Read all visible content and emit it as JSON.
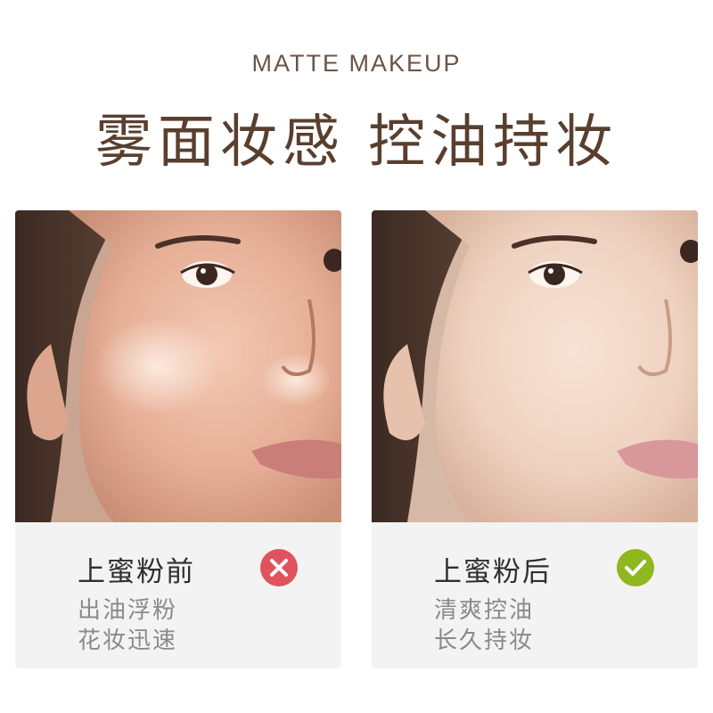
{
  "header": {
    "subtitle": "MATTE MAKEUP",
    "title": "雾面妆感 控油持妆"
  },
  "cards": [
    {
      "title": "上蜜粉前",
      "lines": [
        "出油浮粉",
        "花妆迅速"
      ],
      "status_icon": "x-circle-icon",
      "status_color": "#e0535d"
    },
    {
      "title": "上蜜粉后",
      "lines": [
        "清爽控油",
        "长久持妆"
      ],
      "status_icon": "check-circle-icon",
      "status_color": "#8fb81e"
    }
  ],
  "colors": {
    "title_brown": "#5a3f2e",
    "caption_gray": "#8a8a8a"
  }
}
